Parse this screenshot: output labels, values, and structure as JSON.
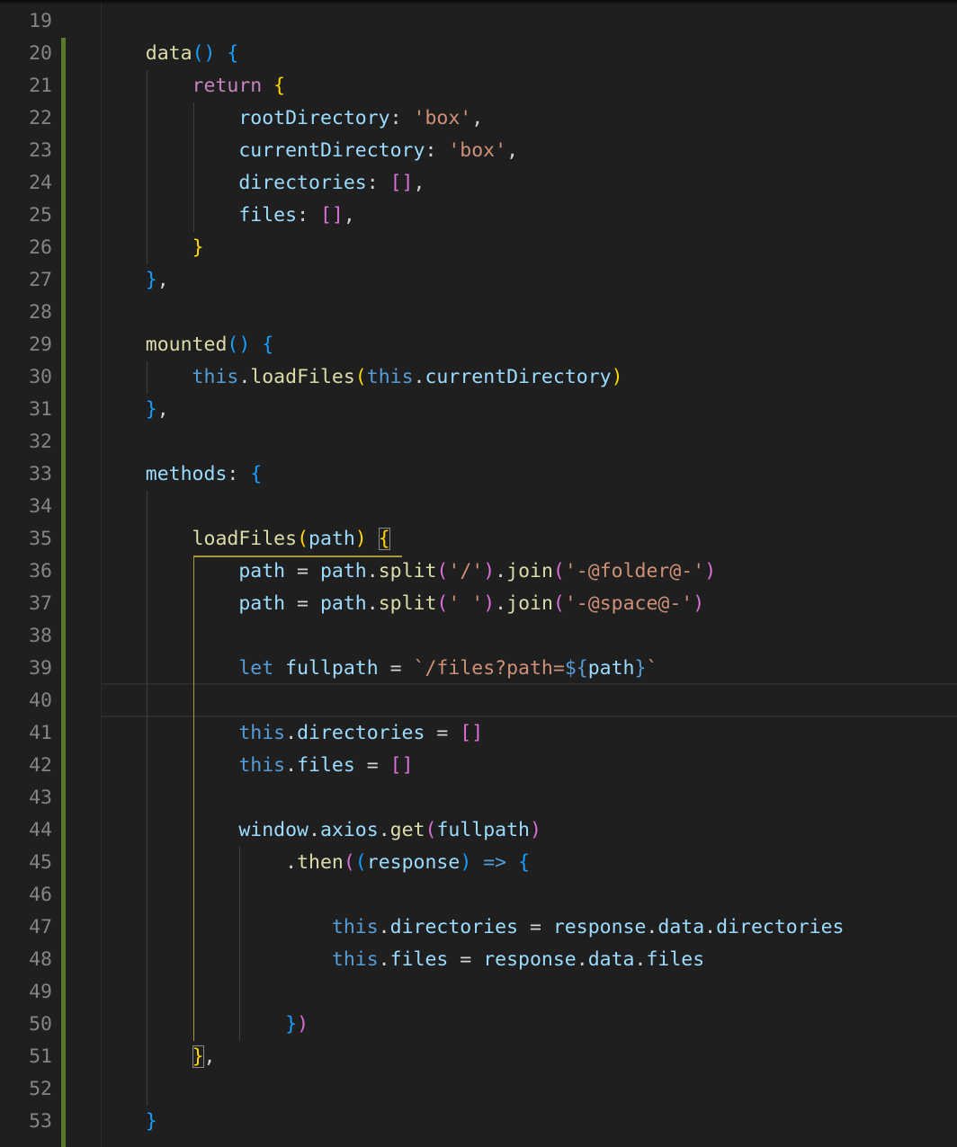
{
  "editor": {
    "line_numbers": [
      "19",
      "20",
      "21",
      "22",
      "23",
      "24",
      "25",
      "26",
      "27",
      "28",
      "29",
      "30",
      "31",
      "32",
      "33",
      "34",
      "35",
      "36",
      "37",
      "38",
      "39",
      "40",
      "41",
      "42",
      "43",
      "44",
      "45",
      "46",
      "47",
      "48",
      "49",
      "50",
      "51",
      "52",
      "53"
    ],
    "lines": [
      [],
      [
        {
          "t": "    data",
          "c": "fn"
        },
        {
          "t": "()",
          "c": "b3"
        },
        {
          "t": " "
        },
        {
          "t": "{",
          "c": "b3"
        }
      ],
      [
        {
          "t": "        return",
          "c": "kw"
        },
        {
          "t": " "
        },
        {
          "t": "{",
          "c": "b1"
        }
      ],
      [
        {
          "t": "            rootDirectory",
          "c": "prop"
        },
        {
          "t": ": "
        },
        {
          "t": "'box'",
          "c": "str"
        },
        {
          "t": ","
        }
      ],
      [
        {
          "t": "            currentDirectory",
          "c": "prop"
        },
        {
          "t": ": "
        },
        {
          "t": "'box'",
          "c": "str"
        },
        {
          "t": ","
        }
      ],
      [
        {
          "t": "            directories",
          "c": "prop"
        },
        {
          "t": ": "
        },
        {
          "t": "[]",
          "c": "b2"
        },
        {
          "t": ","
        }
      ],
      [
        {
          "t": "            files",
          "c": "prop"
        },
        {
          "t": ": "
        },
        {
          "t": "[]",
          "c": "b2"
        },
        {
          "t": ","
        }
      ],
      [
        {
          "t": "        "
        },
        {
          "t": "}",
          "c": "b1"
        }
      ],
      [
        {
          "t": "    "
        },
        {
          "t": "}",
          "c": "b3"
        },
        {
          "t": ","
        }
      ],
      [],
      [
        {
          "t": "    mounted",
          "c": "fn"
        },
        {
          "t": "()",
          "c": "b3"
        },
        {
          "t": " "
        },
        {
          "t": "{",
          "c": "b3"
        }
      ],
      [
        {
          "t": "        this",
          "c": "this"
        },
        {
          "t": "."
        },
        {
          "t": "loadFiles",
          "c": "fn"
        },
        {
          "t": "(",
          "c": "b1"
        },
        {
          "t": "this",
          "c": "this"
        },
        {
          "t": "."
        },
        {
          "t": "currentDirectory",
          "c": "prop"
        },
        {
          "t": ")",
          "c": "b1"
        }
      ],
      [
        {
          "t": "    "
        },
        {
          "t": "}",
          "c": "b3"
        },
        {
          "t": ","
        }
      ],
      [],
      [
        {
          "t": "    methods",
          "c": "prop"
        },
        {
          "t": ": "
        },
        {
          "t": "{",
          "c": "b3"
        }
      ],
      [],
      [
        {
          "t": "        loadFiles",
          "c": "fn"
        },
        {
          "t": "(",
          "c": "b1"
        },
        {
          "t": "path",
          "c": "var"
        },
        {
          "t": ")",
          "c": "b1"
        },
        {
          "t": " "
        },
        {
          "t": "{",
          "c": "b1",
          "box": true
        }
      ],
      [
        {
          "t": "            path",
          "c": "var"
        },
        {
          "t": " = "
        },
        {
          "t": "path",
          "c": "var"
        },
        {
          "t": "."
        },
        {
          "t": "split",
          "c": "fn"
        },
        {
          "t": "(",
          "c": "b2"
        },
        {
          "t": "'/'",
          "c": "str"
        },
        {
          "t": ")",
          "c": "b2"
        },
        {
          "t": "."
        },
        {
          "t": "join",
          "c": "fn"
        },
        {
          "t": "(",
          "c": "b2"
        },
        {
          "t": "'-@folder@-'",
          "c": "str"
        },
        {
          "t": ")",
          "c": "b2"
        }
      ],
      [
        {
          "t": "            path",
          "c": "var"
        },
        {
          "t": " = "
        },
        {
          "t": "path",
          "c": "var"
        },
        {
          "t": "."
        },
        {
          "t": "split",
          "c": "fn"
        },
        {
          "t": "(",
          "c": "b2"
        },
        {
          "t": "' '",
          "c": "str"
        },
        {
          "t": ")",
          "c": "b2"
        },
        {
          "t": "."
        },
        {
          "t": "join",
          "c": "fn"
        },
        {
          "t": "(",
          "c": "b2"
        },
        {
          "t": "'-@space@-'",
          "c": "str"
        },
        {
          "t": ")",
          "c": "b2"
        }
      ],
      [],
      [
        {
          "t": "            let",
          "c": "this"
        },
        {
          "t": " "
        },
        {
          "t": "fullpath",
          "c": "var"
        },
        {
          "t": " = "
        },
        {
          "t": "`/files?path=",
          "c": "str"
        },
        {
          "t": "${",
          "c": "tpl"
        },
        {
          "t": "path",
          "c": "var"
        },
        {
          "t": "}",
          "c": "tpl"
        },
        {
          "t": "`",
          "c": "str"
        }
      ],
      [],
      [
        {
          "t": "            this",
          "c": "this"
        },
        {
          "t": "."
        },
        {
          "t": "directories",
          "c": "prop"
        },
        {
          "t": " = "
        },
        {
          "t": "[]",
          "c": "b2"
        }
      ],
      [
        {
          "t": "            this",
          "c": "this"
        },
        {
          "t": "."
        },
        {
          "t": "files",
          "c": "prop"
        },
        {
          "t": " = "
        },
        {
          "t": "[]",
          "c": "b2"
        }
      ],
      [],
      [
        {
          "t": "            window",
          "c": "var"
        },
        {
          "t": "."
        },
        {
          "t": "axios",
          "c": "prop"
        },
        {
          "t": "."
        },
        {
          "t": "get",
          "c": "fn"
        },
        {
          "t": "(",
          "c": "b2"
        },
        {
          "t": "fullpath",
          "c": "var"
        },
        {
          "t": ")",
          "c": "b2"
        }
      ],
      [
        {
          "t": "                ."
        },
        {
          "t": "then",
          "c": "fn"
        },
        {
          "t": "(",
          "c": "b2"
        },
        {
          "t": "(",
          "c": "b3"
        },
        {
          "t": "response",
          "c": "var"
        },
        {
          "t": ")",
          "c": "b3"
        },
        {
          "t": " "
        },
        {
          "t": "=>",
          "c": "this"
        },
        {
          "t": " "
        },
        {
          "t": "{",
          "c": "b3"
        }
      ],
      [],
      [
        {
          "t": "                    this",
          "c": "this"
        },
        {
          "t": "."
        },
        {
          "t": "directories",
          "c": "prop"
        },
        {
          "t": " = "
        },
        {
          "t": "response",
          "c": "var"
        },
        {
          "t": "."
        },
        {
          "t": "data",
          "c": "prop"
        },
        {
          "t": "."
        },
        {
          "t": "directories",
          "c": "prop"
        }
      ],
      [
        {
          "t": "                    this",
          "c": "this"
        },
        {
          "t": "."
        },
        {
          "t": "files",
          "c": "prop"
        },
        {
          "t": " = "
        },
        {
          "t": "response",
          "c": "var"
        },
        {
          "t": "."
        },
        {
          "t": "data",
          "c": "prop"
        },
        {
          "t": "."
        },
        {
          "t": "files",
          "c": "prop"
        }
      ],
      [],
      [
        {
          "t": "                "
        },
        {
          "t": "}",
          "c": "b3"
        },
        {
          "t": ")",
          "c": "b2"
        }
      ],
      [
        {
          "t": "        "
        },
        {
          "t": "}",
          "c": "b1",
          "box": true
        },
        {
          "t": ","
        }
      ],
      [],
      [
        {
          "t": "    "
        },
        {
          "t": "}",
          "c": "b3"
        }
      ]
    ]
  }
}
